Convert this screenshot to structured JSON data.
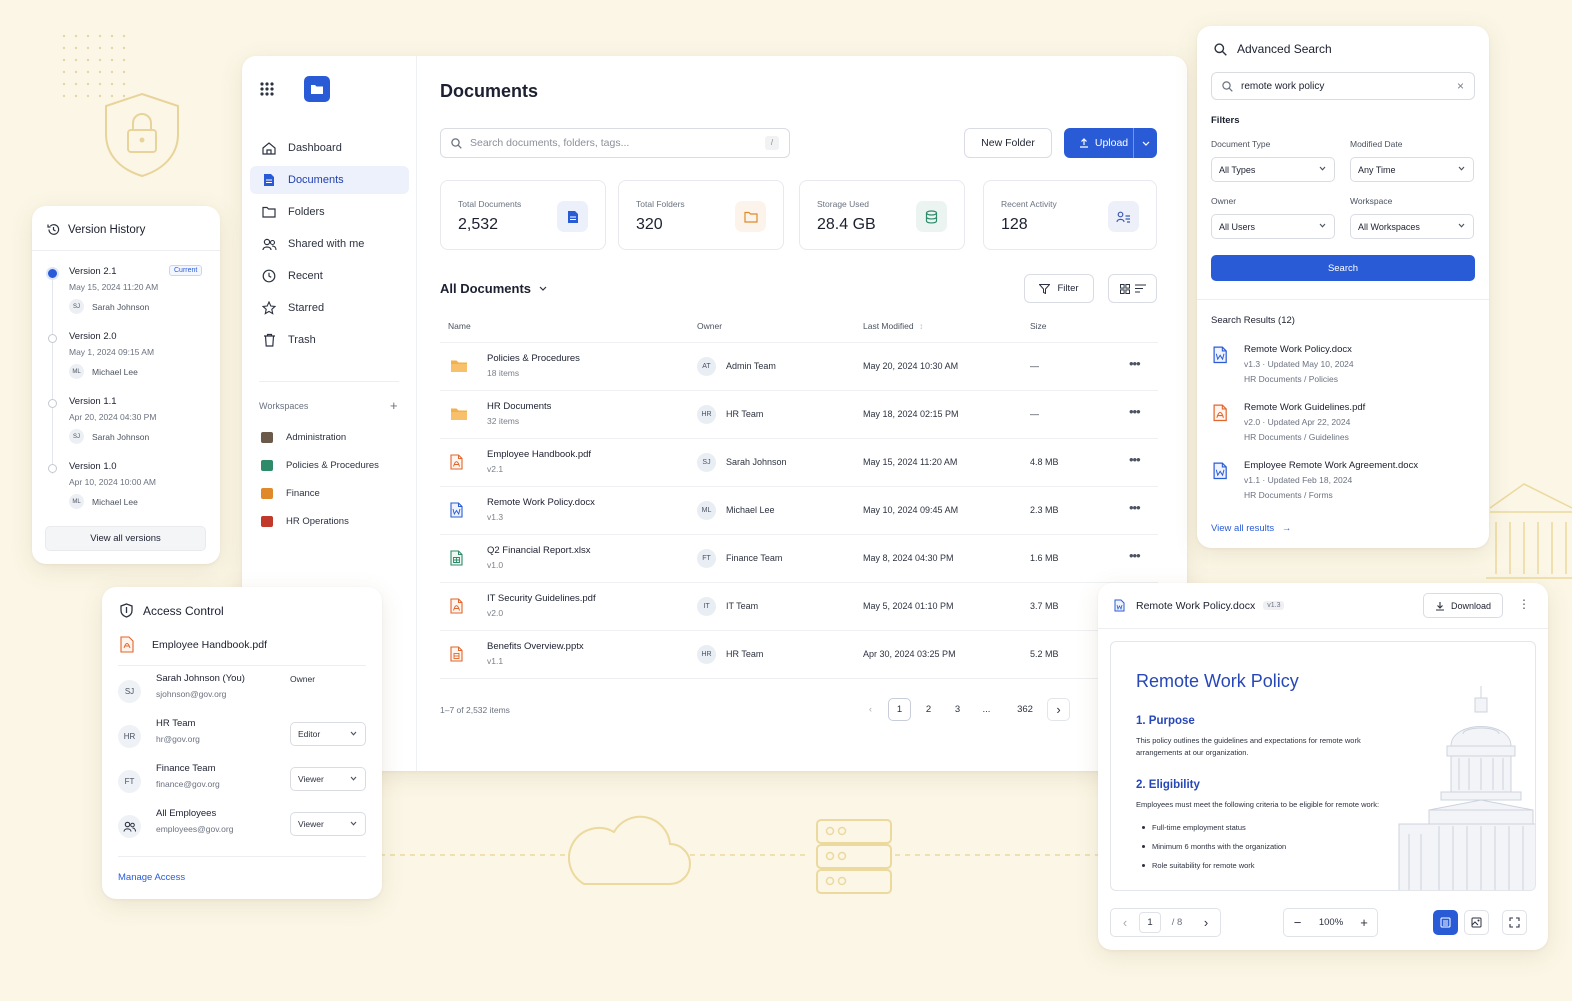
{
  "app": {
    "page_title": "Documents",
    "search_placeholder": "Search documents, folders, tags...",
    "search_shortcut": "/",
    "new_folder_label": "New Folder",
    "upload_label": "Upload",
    "accent_color": "#2a5bd7"
  },
  "sidebar": {
    "items": [
      {
        "label": "Dashboard",
        "icon": "home-icon"
      },
      {
        "label": "Documents",
        "icon": "document-icon"
      },
      {
        "label": "Folders",
        "icon": "folder-icon"
      },
      {
        "label": "Shared with me",
        "icon": "users-icon"
      },
      {
        "label": "Recent",
        "icon": "clock-icon"
      },
      {
        "label": "Starred",
        "icon": "star-icon"
      },
      {
        "label": "Trash",
        "icon": "trash-icon"
      }
    ],
    "workspaces_label": "Workspaces",
    "workspaces": [
      {
        "label": "Administration",
        "color": "#6b5a4a"
      },
      {
        "label": "Policies & Procedures",
        "color": "#2e8b6a"
      },
      {
        "label": "Finance",
        "color": "#e0892b"
      },
      {
        "label": "HR Operations",
        "color": "#c0392b"
      }
    ]
  },
  "stats": [
    {
      "label": "Total Documents",
      "value": "2,532",
      "icon": "document-icon",
      "color": "#2a5bd7"
    },
    {
      "label": "Total Folders",
      "value": "320",
      "icon": "folder-icon",
      "color": "#e0892b"
    },
    {
      "label": "Storage Used",
      "value": "28.4 GB",
      "icon": "database-icon",
      "color": "#2e8b6a"
    },
    {
      "label": "Recent Activity",
      "value": "128",
      "icon": "activity-icon",
      "color": "#3b5bb5"
    }
  ],
  "list": {
    "title": "All Documents",
    "filter_label": "Filter",
    "columns": [
      "Name",
      "Owner",
      "Last Modified",
      "Size"
    ],
    "rows": [
      {
        "name": "Policies & Procedures",
        "sub": "18 items",
        "type": "folder",
        "initials": "AT",
        "owner": "Admin Team",
        "modified": "May 20, 2024 10:30 AM",
        "size": "—"
      },
      {
        "name": "HR Documents",
        "sub": "32 items",
        "type": "folder",
        "initials": "HR",
        "owner": "HR Team",
        "modified": "May 18, 2024 02:15 PM",
        "size": "—"
      },
      {
        "name": "Employee Handbook.pdf",
        "sub": "v2.1",
        "type": "pdf",
        "initials": "SJ",
        "owner": "Sarah Johnson",
        "modified": "May 15, 2024 11:20 AM",
        "size": "4.8 MB"
      },
      {
        "name": "Remote Work Policy.docx",
        "sub": "v1.3",
        "type": "docx",
        "initials": "ML",
        "owner": "Michael Lee",
        "modified": "May 10, 2024 09:45 AM",
        "size": "2.3 MB"
      },
      {
        "name": "Q2 Financial Report.xlsx",
        "sub": "v1.0",
        "type": "xlsx",
        "initials": "FT",
        "owner": "Finance Team",
        "modified": "May 8, 2024 04:30 PM",
        "size": "1.6 MB"
      },
      {
        "name": "IT Security Guidelines.pdf",
        "sub": "v2.0",
        "type": "pdf",
        "initials": "IT",
        "owner": "IT Team",
        "modified": "May 5, 2024 01:10 PM",
        "size": "3.7 MB"
      },
      {
        "name": "Benefits Overview.pptx",
        "sub": "v1.1",
        "type": "pptx",
        "initials": "HR",
        "owner": "HR Team",
        "modified": "Apr 30, 2024 03:25 PM",
        "size": "5.2 MB"
      }
    ],
    "count_text": "1–7 of 2,532 items",
    "pages": [
      "1",
      "2",
      "3",
      "...",
      "362"
    ],
    "current_page": "1"
  },
  "version_history": {
    "title": "Version History",
    "current_badge": "Current",
    "versions": [
      {
        "name": "Version 2.1",
        "date": "May 15, 2024 11:20 AM",
        "initials": "SJ",
        "user": "Sarah Johnson"
      },
      {
        "name": "Version 2.0",
        "date": "May 1, 2024 09:15 AM",
        "initials": "ML",
        "user": "Michael Lee"
      },
      {
        "name": "Version 1.1",
        "date": "Apr 20, 2024 04:30 PM",
        "initials": "SJ",
        "user": "Sarah Johnson"
      },
      {
        "name": "Version 1.0",
        "date": "Apr 10, 2024 10:00 AM",
        "initials": "ML",
        "user": "Michael Lee"
      }
    ],
    "view_all_label": "View all versions"
  },
  "access_control": {
    "title": "Access Control",
    "file": "Employee Handbook.pdf",
    "members": [
      {
        "initials": "SJ",
        "name": "Sarah Johnson (You)",
        "email": "sjohnson@gov.org",
        "role": "Owner"
      },
      {
        "initials": "HR",
        "name": "HR Team",
        "email": "hr@gov.org",
        "role": "Editor"
      },
      {
        "initials": "FT",
        "name": "Finance Team",
        "email": "finance@gov.org",
        "role": "Viewer"
      },
      {
        "initials": "",
        "name": "All Employees",
        "email": "employees@gov.org",
        "role": "Viewer"
      }
    ],
    "manage_label": "Manage Access"
  },
  "advanced_search": {
    "title": "Advanced Search",
    "query": "remote work policy",
    "filters_label": "Filters",
    "filters": [
      {
        "label": "Document Type",
        "value": "All Types"
      },
      {
        "label": "Modified Date",
        "value": "Any Time"
      },
      {
        "label": "Owner",
        "value": "All Users"
      },
      {
        "label": "Workspace",
        "value": "All Workspaces"
      }
    ],
    "search_button": "Search",
    "results_label": "Search Results (12)",
    "results": [
      {
        "name": "Remote Work Policy.docx",
        "meta": "v1.3 · Updated May 10, 2024",
        "path": "HR Documents / Policies",
        "type": "docx"
      },
      {
        "name": "Remote Work Guidelines.pdf",
        "meta": "v2.0 · Updated Apr 22, 2024",
        "path": "HR Documents / Guidelines",
        "type": "pdf"
      },
      {
        "name": "Employee Remote Work Agreement.docx",
        "meta": "v1.1 · Updated Feb 18, 2024",
        "path": "HR Documents / Forms",
        "type": "docx"
      }
    ],
    "view_all_label": "View all results"
  },
  "viewer": {
    "file": "Remote Work Policy.docx",
    "version": "v1.3",
    "download_label": "Download",
    "doc_title": "Remote Work Policy",
    "section1_title": "1. Purpose",
    "section1_text": "This policy outlines the guidelines and expectations for remote work arrangements at our organization.",
    "section2_title": "2. Eligibility",
    "section2_text": "Employees must meet the following criteria to be eligible for remote work:",
    "bullets": [
      "Full-time employment status",
      "Minimum 6 months with the organization",
      "Role suitability for remote work"
    ],
    "page_current": "1",
    "page_total": "/ 8",
    "zoom": "100%"
  }
}
